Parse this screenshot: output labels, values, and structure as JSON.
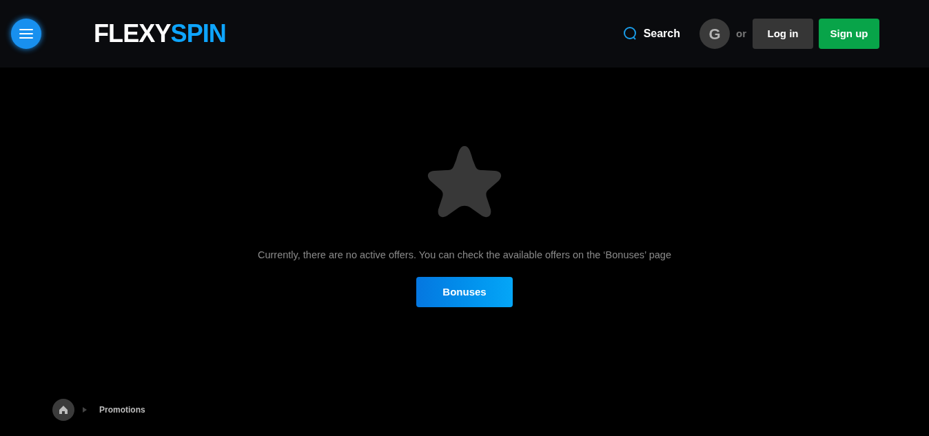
{
  "header": {
    "logo": {
      "part_1": "FLEXY",
      "part_2": "SPIN"
    },
    "search": "Search",
    "google": "G",
    "or": "or",
    "login": "Log in",
    "signup": "Sign up"
  },
  "empty_state": {
    "message": "Currently, there are no active offers. You can check the available offers on the ‘Bonuses’ page",
    "button": "Bonuses"
  },
  "breadcrumb": [
    {
      "label": "Promotions"
    }
  ]
}
